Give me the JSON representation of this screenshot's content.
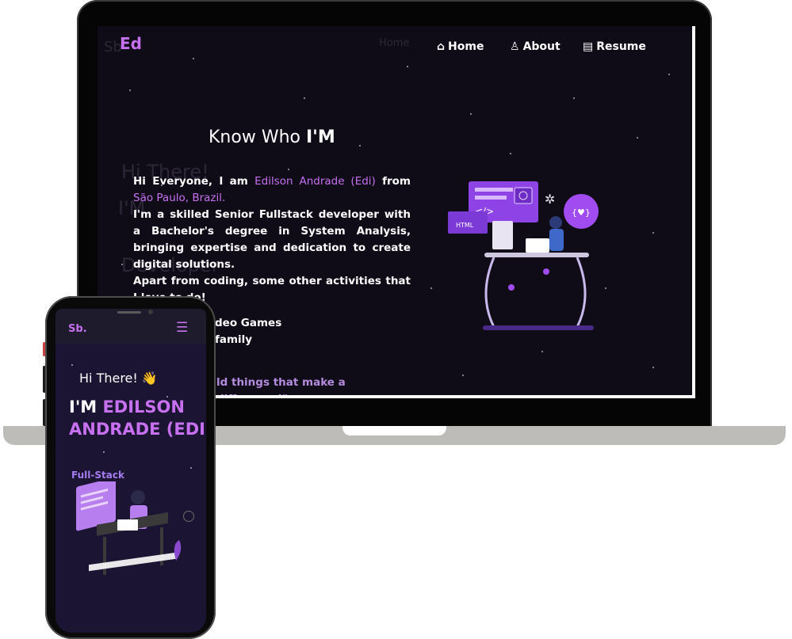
{
  "laptop": {
    "logo": "Ed",
    "nav": {
      "home": "Home",
      "about": "About",
      "resume": "Resume"
    },
    "ghost_text": {
      "nav_home": "Home",
      "hi_there": "Hi There!",
      "im_name": "I'M",
      "role": "Developer",
      "left_fragment": "Sb"
    },
    "about": {
      "title_prefix": "Know Who",
      "title_strong": "I'M",
      "intro_1": "Hi Everyone, I am ",
      "name": "Edilson Andrade (Edi)",
      "intro_2": " from ",
      "location": "São Paulo, Brazil.",
      "bio": "I'm a skilled Senior Fullstack developer with a Bachelor's degree in System Analysis, bringing expertise and dedication to create digital solutions.",
      "activities_intro": "Apart from coding, some other activities that I love to do!",
      "activity_1": "deo Games",
      "activity_2": "family",
      "quote": "ld things that make a difference!\""
    }
  },
  "phone": {
    "logo": "Sb.",
    "greeting": "Hi There!",
    "im": "I'M ",
    "name_line1": "EDILSON",
    "name_line2": "ANDRADE (EDI",
    "role": "Full-Stack"
  }
}
